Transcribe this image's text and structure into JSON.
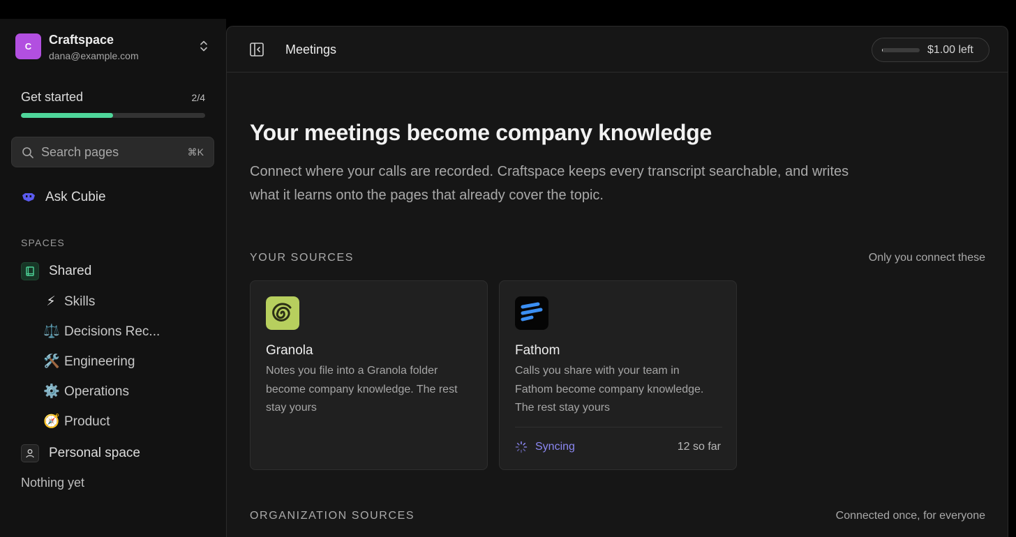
{
  "workspace": {
    "initial": "C",
    "name": "Craftspace",
    "email": "dana@example.com"
  },
  "get_started": {
    "label": "Get started",
    "count": "2/4",
    "progress": 0.5
  },
  "search": {
    "placeholder": "Search pages",
    "shortcut": "⌘K"
  },
  "ask": {
    "label": "Ask Cubie"
  },
  "spaces": {
    "heading": "SPACES",
    "shared": {
      "label": "Shared",
      "children": [
        {
          "emoji": "⚡",
          "label": "Skills",
          "icon": "lightning-icon"
        },
        {
          "emoji": "⚖️",
          "label": "Decisions Rec...",
          "icon": "scales-icon"
        },
        {
          "emoji": "🛠️",
          "label": "Engineering",
          "icon": "tools-icon"
        },
        {
          "emoji": "⚙️",
          "label": "Operations",
          "icon": "gear-icon"
        },
        {
          "emoji": "🧭",
          "label": "Product",
          "icon": "compass-icon"
        }
      ]
    },
    "personal": {
      "label": "Personal space",
      "empty": "Nothing yet"
    }
  },
  "header": {
    "page_title": "Meetings",
    "credit": "$1.00 left",
    "credit_fraction": 0.02
  },
  "main": {
    "title": "Your meetings become company knowledge",
    "description": "Connect where your calls are recorded. Craftspace keeps every transcript searchable, and writes what it learns onto the pages that already cover the topic.",
    "your_sources": {
      "heading": "YOUR SOURCES",
      "note": "Only you connect these",
      "cards": [
        {
          "name": "Granola",
          "logo": "granola-logo",
          "description": "Notes you file into a Granola folder become company knowledge. The rest stay yours"
        },
        {
          "name": "Fathom",
          "logo": "fathom-logo",
          "description": "Calls you share with your team in Fathom become company knowledge. The rest stay yours",
          "status": "Syncing",
          "count": "12 so far"
        }
      ]
    },
    "org_sources": {
      "heading": "ORGANIZATION SOURCES",
      "note": "Connected once, for everyone"
    }
  },
  "colors": {
    "accent_green": "#4fd69a",
    "workspace_purple": "#b24fe0",
    "syncing_purple": "#8b87f2",
    "granola_green": "#b7cf5e",
    "fathom_blue": "#3b8ff3"
  }
}
